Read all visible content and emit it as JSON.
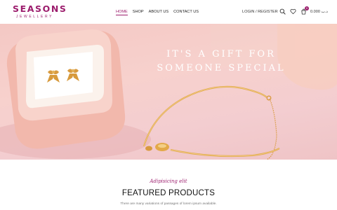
{
  "brand": {
    "name": "SEASONS",
    "tagline": "JEWELLERY",
    "accent": "#9c1d6d"
  },
  "nav": {
    "items": [
      {
        "label": "HOME",
        "active": true
      },
      {
        "label": "SHOP",
        "active": false
      },
      {
        "label": "ABOUT US",
        "active": false
      },
      {
        "label": "CONTACT US",
        "active": false
      }
    ]
  },
  "header": {
    "login_label": "LOGIN / REGISTER",
    "icons": [
      "search-icon",
      "heart-icon",
      "cart-icon"
    ],
    "cart_count": "0",
    "cart_total": "0.000 د.ب"
  },
  "hero": {
    "line1": "IT'S A GIFT FOR",
    "line2": "SOMEONE SPECIAL"
  },
  "featured": {
    "subtitle": "Adipisicing elit",
    "title": "FEATURED PRODUCTS",
    "description": "There are many variations of passages of lorem ipsum available."
  }
}
